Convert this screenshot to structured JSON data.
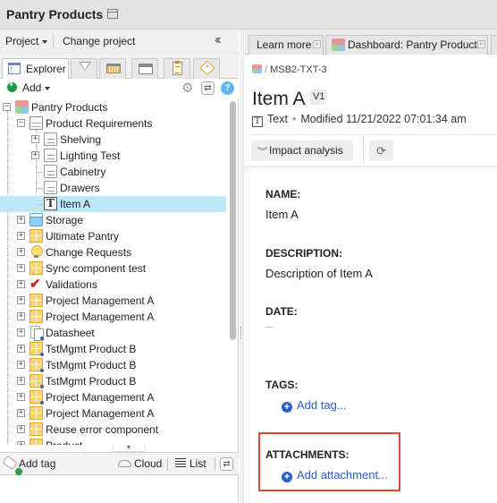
{
  "app": {
    "title": "Pantry Products"
  },
  "left_panel": {
    "project_menu": "Project",
    "change_project": "Change project",
    "tabs": [
      {
        "name": "explorer",
        "label": "Explorer",
        "icon": "explorer-icon",
        "active": true
      },
      {
        "name": "filter",
        "label": "",
        "icon": "filter-icon"
      },
      {
        "name": "grid",
        "label": "",
        "icon": "grid-view-icon"
      },
      {
        "name": "window",
        "label": "",
        "icon": "window-icon"
      },
      {
        "name": "clipboard",
        "label": "",
        "icon": "clipboard-icon"
      },
      {
        "name": "tags",
        "label": "",
        "icon": "tag-icon"
      }
    ],
    "add_label": "Add",
    "help_label": "?",
    "tree": [
      {
        "label": "Pantry Products",
        "icon": "project-icon",
        "level": 0,
        "expander": "minus"
      },
      {
        "label": "Product Requirements",
        "icon": "requirements-icon",
        "level": 1,
        "expander": "minus"
      },
      {
        "label": "Shelving",
        "icon": "document-icon",
        "level": 2,
        "expander": "plus"
      },
      {
        "label": "Lighting Test",
        "icon": "document-icon",
        "level": 2,
        "expander": "plus"
      },
      {
        "label": "Cabinetry",
        "icon": "document-icon",
        "level": 2,
        "expander": ""
      },
      {
        "label": "Drawers",
        "icon": "document-icon",
        "level": 2,
        "expander": ""
      },
      {
        "label": "Item A",
        "icon": "text-icon",
        "level": 2,
        "expander": "",
        "selected": true
      },
      {
        "label": "Storage",
        "icon": "storage-icon",
        "level": 1,
        "expander": "plus"
      },
      {
        "label": "Ultimate Pantry",
        "icon": "grid-folder-icon",
        "level": 1,
        "expander": "plus"
      },
      {
        "label": "Change Requests",
        "icon": "lightbulb-icon",
        "level": 1,
        "expander": "plus"
      },
      {
        "label": "Sync component test",
        "icon": "grid-folder-icon",
        "level": 1,
        "expander": "plus"
      },
      {
        "label": "Validations",
        "icon": "checkmark-icon",
        "level": 1,
        "expander": "plus"
      },
      {
        "label": "Project Management A",
        "icon": "grid-folder-icon",
        "level": 1,
        "expander": "plus"
      },
      {
        "label": "Project Management A",
        "icon": "grid-folder-icon",
        "level": 1,
        "expander": "plus"
      },
      {
        "label": "Datasheet",
        "icon": "datasheet-icon",
        "level": 1,
        "expander": "plus",
        "synced": true
      },
      {
        "label": "TstMgmt Product B",
        "icon": "grid-folder-icon",
        "level": 1,
        "expander": "plus",
        "synced": true
      },
      {
        "label": "TstMgmt Product B",
        "icon": "grid-folder-icon",
        "level": 1,
        "expander": "plus",
        "synced": true
      },
      {
        "label": "TstMgmt Product B",
        "icon": "grid-folder-icon",
        "level": 1,
        "expander": "plus",
        "synced": true
      },
      {
        "label": "Project Management A",
        "icon": "grid-folder-icon",
        "level": 1,
        "expander": "plus",
        "synced": true
      },
      {
        "label": "Project Management A",
        "icon": "grid-folder-icon",
        "level": 1,
        "expander": "plus"
      },
      {
        "label": "Reuse error component",
        "icon": "grid-folder-icon",
        "level": 1,
        "expander": "plus"
      },
      {
        "label": "Product",
        "icon": "grid-folder-icon",
        "level": 1,
        "expander": "plus"
      }
    ],
    "bottom_bar": {
      "add_tag": "Add tag",
      "cloud": "Cloud",
      "list": "List"
    }
  },
  "right_panel": {
    "tabs": [
      {
        "label": "Learn more"
      },
      {
        "label": "Dashboard: Pantry Products",
        "icon": "project-icon"
      }
    ],
    "breadcrumb": {
      "separator": "/",
      "item": "MSB2-TXT-3"
    },
    "title": "Item A",
    "version": "V1",
    "meta": {
      "type": "Text",
      "modified": "Modified 11/21/2022 07:01:34 am"
    },
    "impact_analysis": "Impact analysis",
    "fields": {
      "name_label": "NAME:",
      "name_value": "Item A",
      "description_label": "DESCRIPTION:",
      "description_value": "Description of Item A",
      "date_label": "DATE:",
      "date_value": "",
      "tags_label": "TAGS:",
      "add_tag_link": "Add tag...",
      "attachments_label": "ATTACHMENTS:",
      "add_attachment_link": "Add attachment..."
    }
  },
  "colors": {
    "selection": "#bde6f7",
    "link": "#2a5ec8",
    "highlight_box": "#d94f2b",
    "add_green": "#1b9a4a"
  }
}
